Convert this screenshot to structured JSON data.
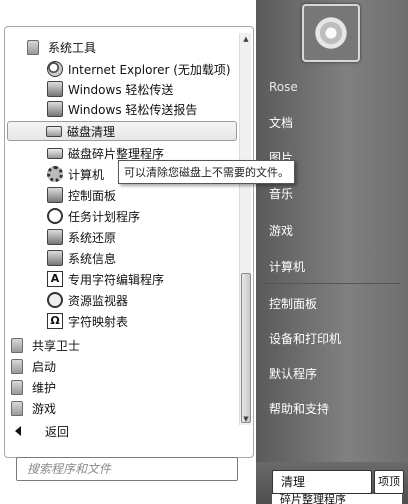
{
  "tree": {
    "folder_system_tools": "系统工具",
    "items": [
      {
        "label": "Internet Explorer (无加载项)",
        "icon": "ie-icon"
      },
      {
        "label": "Windows 轻松传送",
        "icon": "transfer-icon"
      },
      {
        "label": "Windows 轻松传送报告",
        "icon": "transfer-report-icon"
      },
      {
        "label": "磁盘清理",
        "icon": "disk-cleanup-icon"
      },
      {
        "label": "磁盘碎片整理程序",
        "icon": "defrag-icon"
      },
      {
        "label": "计算机",
        "icon": "computer-icon"
      },
      {
        "label": "控制面板",
        "icon": "control-panel-icon"
      },
      {
        "label": "任务计划程序",
        "icon": "clock-icon"
      },
      {
        "label": "系统还原",
        "icon": "restore-icon"
      },
      {
        "label": "系统信息",
        "icon": "info-icon"
      },
      {
        "label": "专用字符编辑程序",
        "icon": "char-edit-icon"
      },
      {
        "label": "资源监视器",
        "icon": "monitor-icon"
      },
      {
        "label": "字符映射表",
        "icon": "charmap-icon"
      }
    ],
    "folders": [
      {
        "label": "共享卫士"
      },
      {
        "label": "启动"
      },
      {
        "label": "维护"
      },
      {
        "label": "游戏"
      }
    ]
  },
  "tooltip": "可以清除您磁盘上不需要的文件。",
  "back_label": "返回",
  "search_placeholder": "搜索程序和文件",
  "right_menu": {
    "user": "Rose",
    "items": [
      "文档",
      "图片",
      "音乐",
      "游戏",
      "计算机",
      "控制面板",
      "设备和打印机",
      "默认程序",
      "帮助和支持"
    ]
  },
  "shutdown": {
    "label": "清理",
    "arrow": "项顶",
    "sub": "碎片整理程序"
  }
}
